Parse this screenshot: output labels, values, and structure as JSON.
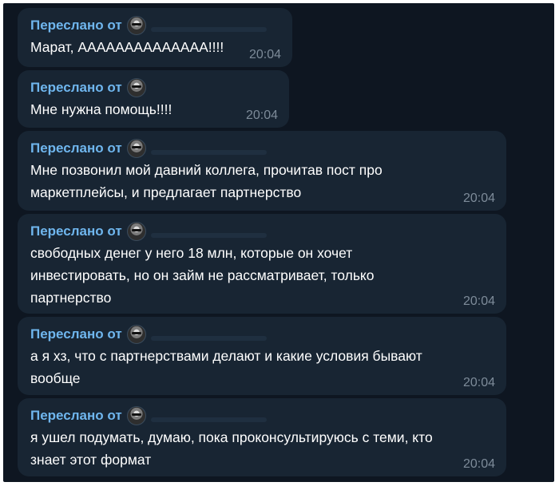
{
  "messages": [
    {
      "forwarded_label": "Переслано от",
      "lines": [
        "Марат, АААААААААААААА!!!!"
      ],
      "time": "20:04"
    },
    {
      "forwarded_label": "Переслано от",
      "lines": [
        "Мне нужна помощь!!!!"
      ],
      "time": "20:04"
    },
    {
      "forwarded_label": "Переслано от",
      "lines": [
        "Мне позвонил мой давний коллега, прочитав пост про",
        "маркетплейсы, и предлагает партнерство"
      ],
      "time": "20:04"
    },
    {
      "forwarded_label": "Переслано от",
      "lines": [
        "свободных денег у него 18 млн, которые он хочет",
        "инвестировать, но он займ не рассматривает, только",
        "партнерство"
      ],
      "time": "20:04"
    },
    {
      "forwarded_label": "Переслано от",
      "lines": [
        "а я хз, что с партнерствами делают и какие условия бывают",
        "вообще"
      ],
      "time": "20:04"
    },
    {
      "forwarded_label": "Переслано от",
      "lines": [
        "я ушел подумать, думаю, пока проконсультируюсь с теми, кто",
        "знает этот формат"
      ],
      "time": "20:04"
    }
  ],
  "colors": {
    "chat_background": "#0e1621",
    "bubble": "#182533",
    "forward_label": "#6fb6ee",
    "text": "#ffffff",
    "timestamp": "#7d8b99"
  },
  "icons": {
    "sender_avatar": "avatar-icon"
  }
}
